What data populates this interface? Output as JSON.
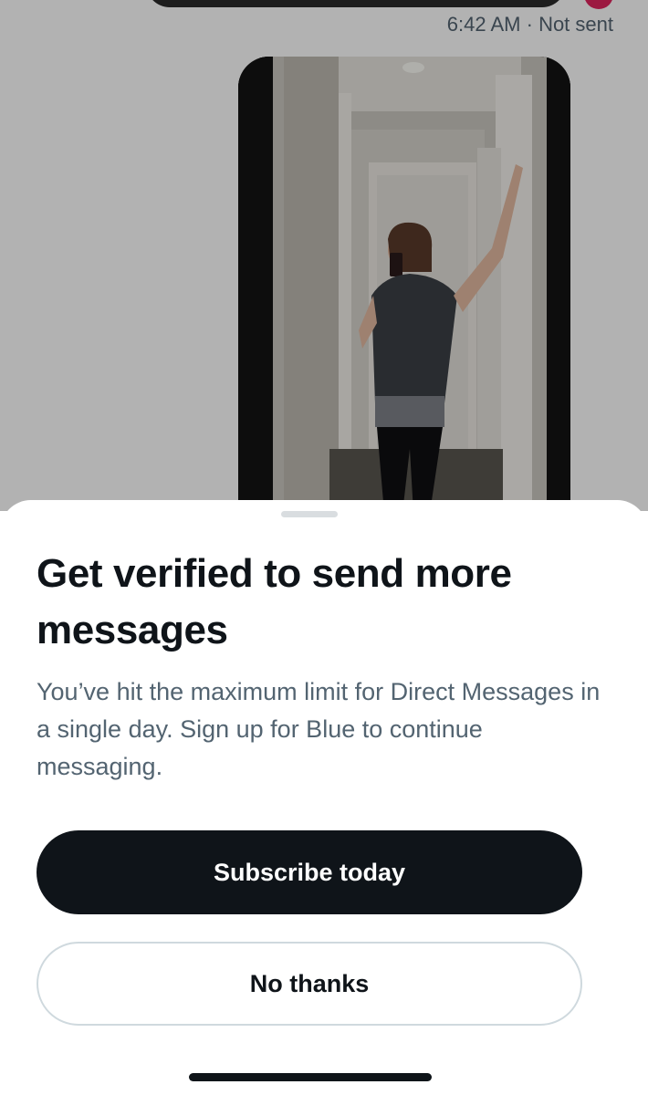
{
  "conversation": {
    "message_time": "6:42 AM",
    "message_status": "· Not sent",
    "status_icon": "error-icon",
    "status_color": "#e0245e",
    "attachment": "mirror-selfie-photo"
  },
  "sheet": {
    "title": "Get verified to send more messages",
    "body": "You’ve hit the maximum limit for Direct Messages in a single day. Sign up for Blue to continue messaging.",
    "primary_button": "Subscribe today",
    "secondary_button": "No thanks"
  },
  "colors": {
    "text_primary": "#0f1419",
    "text_secondary": "#536471",
    "button_dark": "#0f1419",
    "button_outline": "#cfd9de"
  }
}
